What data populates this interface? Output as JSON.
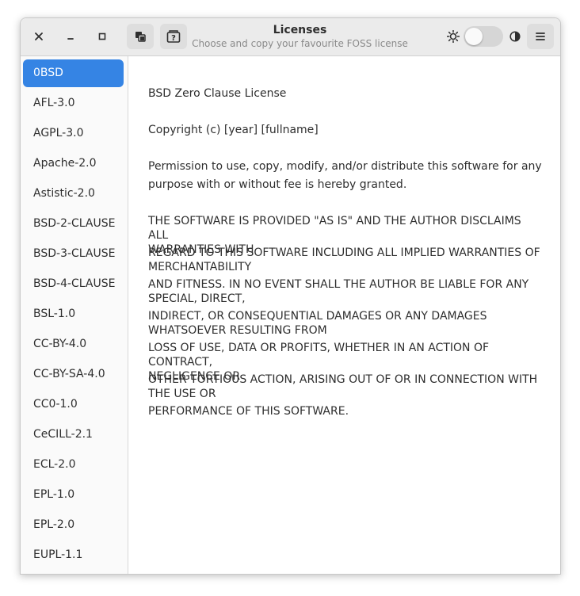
{
  "window": {
    "title": "Licenses",
    "subtitle": "Choose and copy your favourite FOSS license"
  },
  "controls": {
    "close_icon": "close-icon",
    "minimize_icon": "minimize-icon",
    "maximize_icon": "maximize-icon",
    "copy_icon": "copy-icon",
    "help_icon": "help-icon",
    "light_icon": "sun-icon",
    "dark_icon": "moon-icon",
    "menu_icon": "hamburger-menu-icon",
    "dark_mode_on": false
  },
  "sidebar": {
    "selected_index": 0,
    "items": [
      {
        "label": "0BSD"
      },
      {
        "label": "AFL-3.0"
      },
      {
        "label": "AGPL-3.0"
      },
      {
        "label": "Apache-2.0"
      },
      {
        "label": "Astistic-2.0"
      },
      {
        "label": "BSD-2-CLAUSE"
      },
      {
        "label": "BSD-3-CLAUSE"
      },
      {
        "label": "BSD-4-CLAUSE"
      },
      {
        "label": "BSL-1.0"
      },
      {
        "label": "CC-BY-4.0"
      },
      {
        "label": "CC-BY-SA-4.0"
      },
      {
        "label": "CC0-1.0"
      },
      {
        "label": "CeCILL-2.1"
      },
      {
        "label": "ECL-2.0"
      },
      {
        "label": "EPL-1.0"
      },
      {
        "label": "EPL-2.0"
      },
      {
        "label": "EUPL-1.1"
      }
    ]
  },
  "license": {
    "heading": "BSD Zero Clause License",
    "copyright": "Copyright (c) [year] [fullname]",
    "permission_line1": "Permission to use, copy, modify, and/or distribute this software for any",
    "permission_line2": "purpose with or without fee is hereby granted.",
    "disclaimer": [
      "THE SOFTWARE IS PROVIDED \"AS IS\" AND THE AUTHOR DISCLAIMS ALL",
      "WARRANTIES WITH",
      "REGARD TO THIS SOFTWARE INCLUDING ALL IMPLIED WARRANTIES OF",
      "MERCHANTABILITY",
      "AND FITNESS. IN NO EVENT SHALL THE AUTHOR BE LIABLE FOR ANY",
      "SPECIAL, DIRECT,",
      "INDIRECT, OR CONSEQUENTIAL DAMAGES OR ANY DAMAGES",
      "WHATSOEVER RESULTING FROM",
      "LOSS OF USE, DATA OR PROFITS, WHETHER IN AN ACTION OF CONTRACT,",
      "NEGLIGENCE OR",
      "OTHER TORTIOUS ACTION, ARISING OUT OF OR IN CONNECTION WITH",
      "THE USE OR",
      "PERFORMANCE OF THIS SOFTWARE."
    ]
  },
  "colors": {
    "accent": "#3584e4",
    "headerbar": "#ebebeb",
    "sidebar": "#fafafa",
    "text": "#2e2e2e"
  }
}
